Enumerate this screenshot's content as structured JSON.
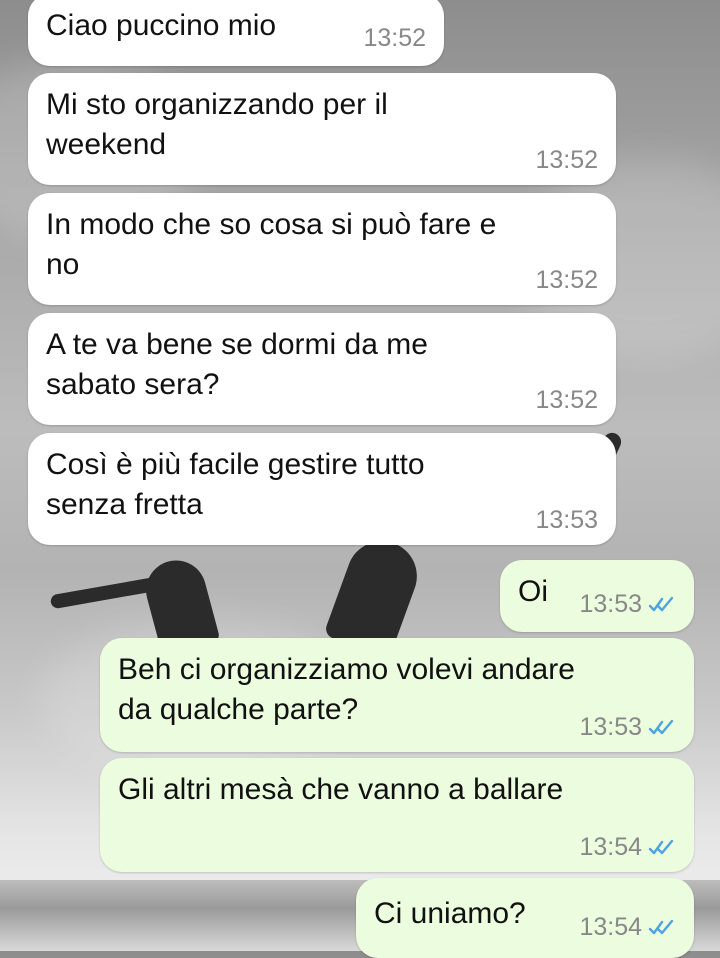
{
  "messages": [
    {
      "text": "Ciao puccino mio",
      "time": "13:52",
      "direction": "incoming"
    },
    {
      "text": "Mi sto organizzando per il\nweekend",
      "time": "13:52",
      "direction": "incoming"
    },
    {
      "text": "In modo che so cosa si può fare e\nno",
      "time": "13:52",
      "direction": "incoming"
    },
    {
      "text": "A te va bene se dormi da me\nsabato sera?",
      "time": "13:52",
      "direction": "incoming"
    },
    {
      "text": "Così è più facile gestire tutto\nsenza fretta",
      "time": "13:53",
      "direction": "incoming"
    },
    {
      "text": "Oi",
      "time": "13:53",
      "direction": "outgoing",
      "status": "read"
    },
    {
      "text": "Beh ci organizziamo volevi andare\nda qualche parte?",
      "time": "13:53",
      "direction": "outgoing",
      "status": "read"
    },
    {
      "text": "Gli altri mesà che vanno a ballare",
      "time": "13:54",
      "direction": "outgoing",
      "status": "read"
    },
    {
      "text": "Ci uniamo?",
      "time": "13:54",
      "direction": "outgoing",
      "status": "read"
    }
  ],
  "colors": {
    "incoming_bubble": "#ffffff",
    "outgoing_bubble": "#ecfcdf",
    "read_ticks": "#4fa3e0",
    "timestamp": "#888888"
  },
  "icons": {
    "read_receipt": "double-check-icon"
  }
}
